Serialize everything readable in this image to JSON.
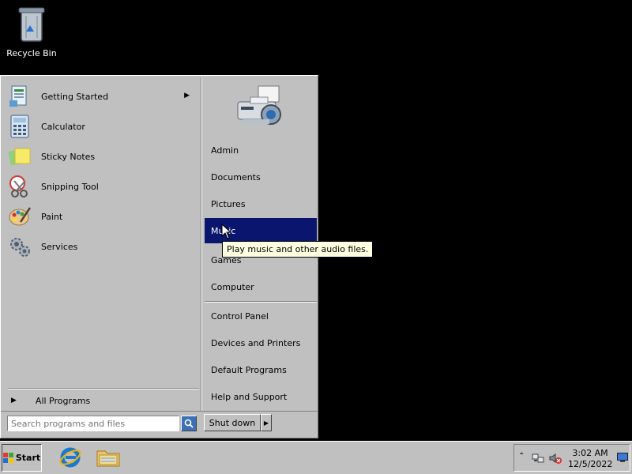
{
  "desktop": {
    "icons": [
      {
        "label": "Recycle Bin",
        "icon": "recycle-bin-icon"
      }
    ]
  },
  "start_menu": {
    "programs": [
      {
        "label": "Getting Started",
        "icon": "getting-started-icon",
        "has_submenu": true
      },
      {
        "label": "Calculator",
        "icon": "calculator-icon"
      },
      {
        "label": "Sticky Notes",
        "icon": "sticky-notes-icon"
      },
      {
        "label": "Snipping Tool",
        "icon": "snipping-tool-icon"
      },
      {
        "label": "Paint",
        "icon": "paint-icon"
      },
      {
        "label": "Services",
        "icon": "services-icon"
      }
    ],
    "all_programs": "All Programs",
    "search_placeholder": "Search programs and files",
    "places": [
      {
        "label": "Admin"
      },
      {
        "label": "Documents"
      },
      {
        "label": "Pictures"
      },
      {
        "label": "Music",
        "hovered": true
      },
      {
        "label": "Games"
      },
      {
        "label": "Computer"
      }
    ],
    "system": [
      {
        "label": "Control Panel"
      },
      {
        "label": "Devices and Printers"
      },
      {
        "label": "Default Programs"
      },
      {
        "label": "Help and Support"
      }
    ],
    "shutdown_label": "Shut down",
    "tooltip": "Play music and other audio files."
  },
  "taskbar": {
    "start_label": "Start",
    "pinned": [
      {
        "icon": "internet-explorer-icon"
      },
      {
        "icon": "windows-explorer-icon"
      }
    ],
    "clock_time": "3:02 AM",
    "clock_date": "12/5/2022"
  },
  "colors": {
    "desktop": "#000000",
    "menu_bg": "#c0c0c0",
    "highlight": "#0a166e",
    "tooltip_bg": "#ffffe1"
  }
}
